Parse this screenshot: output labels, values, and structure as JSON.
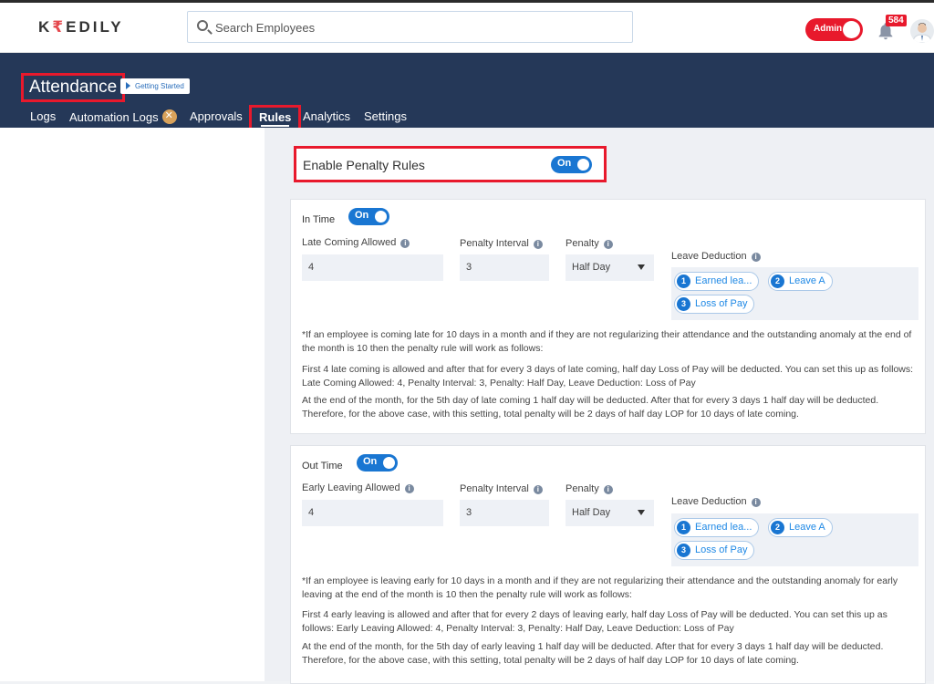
{
  "header": {
    "logo_prefix": "K",
    "logo_r": "₹",
    "logo_suffix": "EDILY",
    "search_placeholder": "Search Employees",
    "admin_toggle_label": "Admin",
    "notification_count": "584"
  },
  "banner": {
    "title": "Attendance",
    "getting_started": "Getting Started",
    "tabs": [
      {
        "label": "Logs"
      },
      {
        "label": "Automation Logs"
      },
      {
        "label": "Approvals"
      },
      {
        "label": "Rules",
        "active": true
      },
      {
        "label": "Analytics"
      },
      {
        "label": "Settings"
      }
    ]
  },
  "penalty": {
    "enable_label": "Enable Penalty Rules",
    "enable_state": "On"
  },
  "in_time": {
    "title": "In Time",
    "state": "On",
    "allowed_label": "Late Coming Allowed",
    "allowed_value": "4",
    "interval_label": "Penalty Interval",
    "interval_value": "3",
    "penalty_label": "Penalty",
    "penalty_value": "Half Day",
    "leave_label": "Leave Deduction",
    "chips": [
      {
        "num": "1",
        "label": "Earned lea..."
      },
      {
        "num": "2",
        "label": "Leave A"
      },
      {
        "num": "3",
        "label": "Loss of Pay"
      }
    ],
    "notes": [
      "*If an employee is coming late for 10 days in a month and if they are not regularizing their attendance and the outstanding anomaly at the end of the month is 10 then the penalty rule will work as follows:",
      "First 4 late coming is allowed and after that for every 3 days of late coming, half day Loss of Pay will be deducted. You can set this up as follows: Late Coming Allowed: 4, Penalty Interval: 3, Penalty: Half Day, Leave Deduction: Loss of Pay",
      "At the end of the month, for the 5th day of late coming 1 half day will be deducted. After that for every 3 days 1 half day will be deducted. Therefore, for the above case, with this setting, total penalty will be 2 days of half day LOP for 10 days of late coming."
    ]
  },
  "out_time": {
    "title": "Out Time",
    "state": "On",
    "allowed_label": "Early Leaving Allowed",
    "allowed_value": "4",
    "interval_label": "Penalty Interval",
    "interval_value": "3",
    "penalty_label": "Penalty",
    "penalty_value": "Half Day",
    "leave_label": "Leave Deduction",
    "chips": [
      {
        "num": "1",
        "label": "Earned lea..."
      },
      {
        "num": "2",
        "label": "Leave A"
      },
      {
        "num": "3",
        "label": "Loss of Pay"
      }
    ],
    "notes": [
      "*If an employee is leaving early for 10 days in a month and if they are not regularizing their attendance and the outstanding anomaly for early leaving at the end of the month is 10 then the penalty rule will work as follows:",
      "First 4 early leaving is allowed and after that for every 2 days of leaving early, half day Loss of Pay will be deducted. You can set this up as follows: Early Leaving Allowed: 4, Penalty Interval: 3, Penalty: Half Day, Leave Deduction: Loss of Pay",
      "At the end of the month, for the 5th day of early leaving 1 half day will be deducted. After that for every 3 days 1 half day will be deducted. Therefore, for the above case, with this setting, total penalty will be 2 days of half day LOP for 10 days of late coming."
    ]
  }
}
